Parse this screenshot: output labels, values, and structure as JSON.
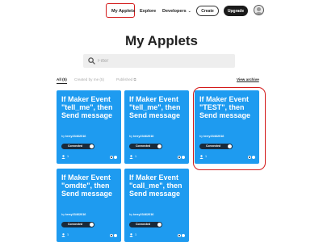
{
  "nav": {
    "my_applets": "My Applets",
    "explore": "Explore",
    "developers": "Developers",
    "create": "Create",
    "upgrade": "Upgrade"
  },
  "page_title": "My Applets",
  "search": {
    "placeholder": "Filter",
    "value": ""
  },
  "tabs": {
    "all": "All (5)",
    "created_by_me": "Created by me (5)",
    "published": "Published"
  },
  "view_archive": "View archive",
  "colors": {
    "card_bg": "#1e9bf0",
    "highlight": "#d31a1a",
    "toggle_bg": "#1a2a3a"
  },
  "applets": [
    {
      "title": "If Maker Event \"tell_me\", then Send message",
      "byline_prefix": "by",
      "author": "terry23462016",
      "status": "Connected",
      "user_count": "1",
      "highlighted": false
    },
    {
      "title": "If Maker Event \"tell_me\", then Send message",
      "byline_prefix": "by",
      "author": "terry23462016",
      "status": "Connected",
      "user_count": "1",
      "highlighted": false
    },
    {
      "title": "If Maker Event \"TEST\", then Send message",
      "byline_prefix": "by",
      "author": "terry23462016",
      "status": "Connected",
      "user_count": "1",
      "highlighted": true
    },
    {
      "title": "If Maker Event \"omdte\", then Send message",
      "byline_prefix": "by",
      "author": "terry23462016",
      "status": "Connected",
      "user_count": "1",
      "highlighted": false
    },
    {
      "title": "If Maker Event \"call_me\", then Send message",
      "byline_prefix": "by",
      "author": "terry23462016",
      "status": "Connected",
      "user_count": "1",
      "highlighted": false
    }
  ]
}
